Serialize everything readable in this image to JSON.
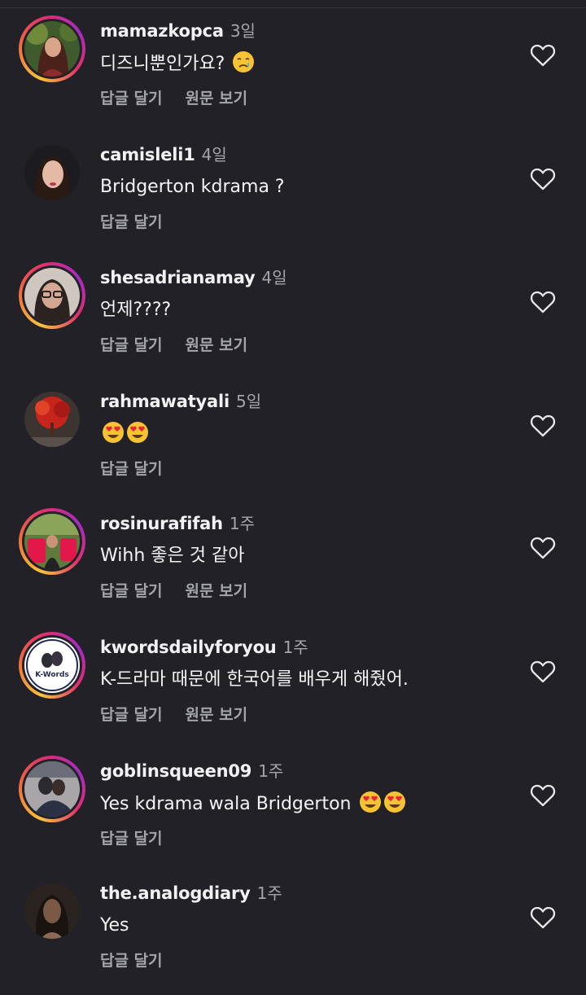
{
  "comments": [
    {
      "username": "mamazkopca",
      "time": "3일",
      "text": "디즈니뿐인가요? ",
      "emoji": [
        "crying-face"
      ],
      "reply_label": "답글 달기",
      "see_original_label": "원문 보기",
      "has_story_ring": true
    },
    {
      "username": "camisleli1",
      "time": "4일",
      "text": "Bridgerton kdrama ?",
      "emoji": [],
      "reply_label": "답글 달기",
      "has_story_ring": false
    },
    {
      "username": "shesadrianamay",
      "time": "4일",
      "text": "언제????",
      "emoji": [],
      "reply_label": "답글 달기",
      "see_original_label": "원문 보기",
      "has_story_ring": true
    },
    {
      "username": "rahmawatyali",
      "time": "5일",
      "text": "",
      "emoji": [
        "heart-eyes",
        "heart-eyes"
      ],
      "reply_label": "답글 달기",
      "has_story_ring": false
    },
    {
      "username": "rosinurafifah",
      "time": "1주",
      "text": "Wihh 좋은 것 같아",
      "emoji": [],
      "reply_label": "답글 달기",
      "see_original_label": "원문 보기",
      "has_story_ring": true
    },
    {
      "username": "kwordsdailyforyou",
      "time": "1주",
      "text": "K-드라마 때문에 한국어를 배우게 해줬어.",
      "emoji": [],
      "reply_label": "답글 달기",
      "see_original_label": "원문 보기",
      "has_story_ring": true,
      "avatar_logo_text": "K-Words"
    },
    {
      "username": "goblinsqueen09",
      "time": "1주",
      "text": "Yes kdrama wala Bridgerton ",
      "emoji": [
        "heart-eyes",
        "heart-eyes"
      ],
      "reply_label": "답글 달기",
      "has_story_ring": true
    },
    {
      "username": "the.analogdiary",
      "time": "1주",
      "text": "Yes",
      "emoji": [],
      "reply_label": "답글 달기",
      "has_story_ring": false
    }
  ],
  "colors": {
    "background": "#212127",
    "text_primary": "#f2f2f4",
    "text_secondary": "#a4a4ad",
    "story_ring": [
      "#f9c33c",
      "#e1306c",
      "#a42bc4"
    ]
  }
}
